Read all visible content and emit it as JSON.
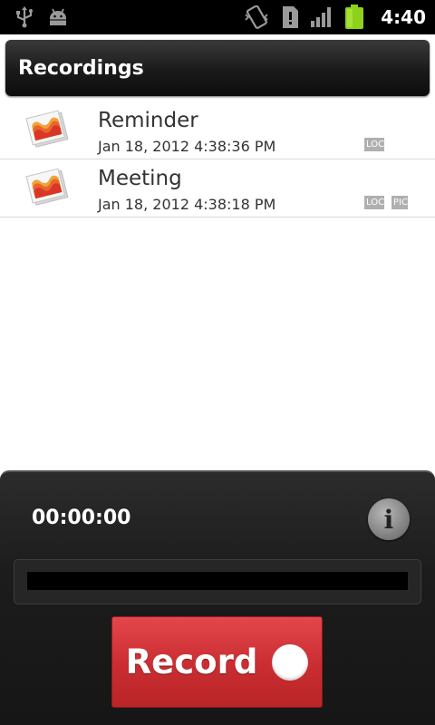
{
  "status_bar": {
    "time": "4:40",
    "left_icons": [
      "usb-icon",
      "android-debug-icon"
    ],
    "right_icons": [
      "vibrate-icon",
      "sd-card-alert-icon",
      "signal-icon",
      "battery-icon"
    ],
    "battery_color": "#8ed11a"
  },
  "title_bar": {
    "title": "Recordings"
  },
  "recordings": [
    {
      "name": "Reminder",
      "date": "Jan 18, 2012 4:38:36 PM",
      "tags": [
        "LOC"
      ]
    },
    {
      "name": "Meeting",
      "date": "Jan 18, 2012 4:38:18 PM",
      "tags": [
        "LOC",
        "PIC"
      ]
    }
  ],
  "recorder": {
    "timer": "00:00:00",
    "info_icon": "info-icon",
    "info_glyph": "i",
    "record_label": "Record",
    "record_color": "#d83a3e"
  }
}
